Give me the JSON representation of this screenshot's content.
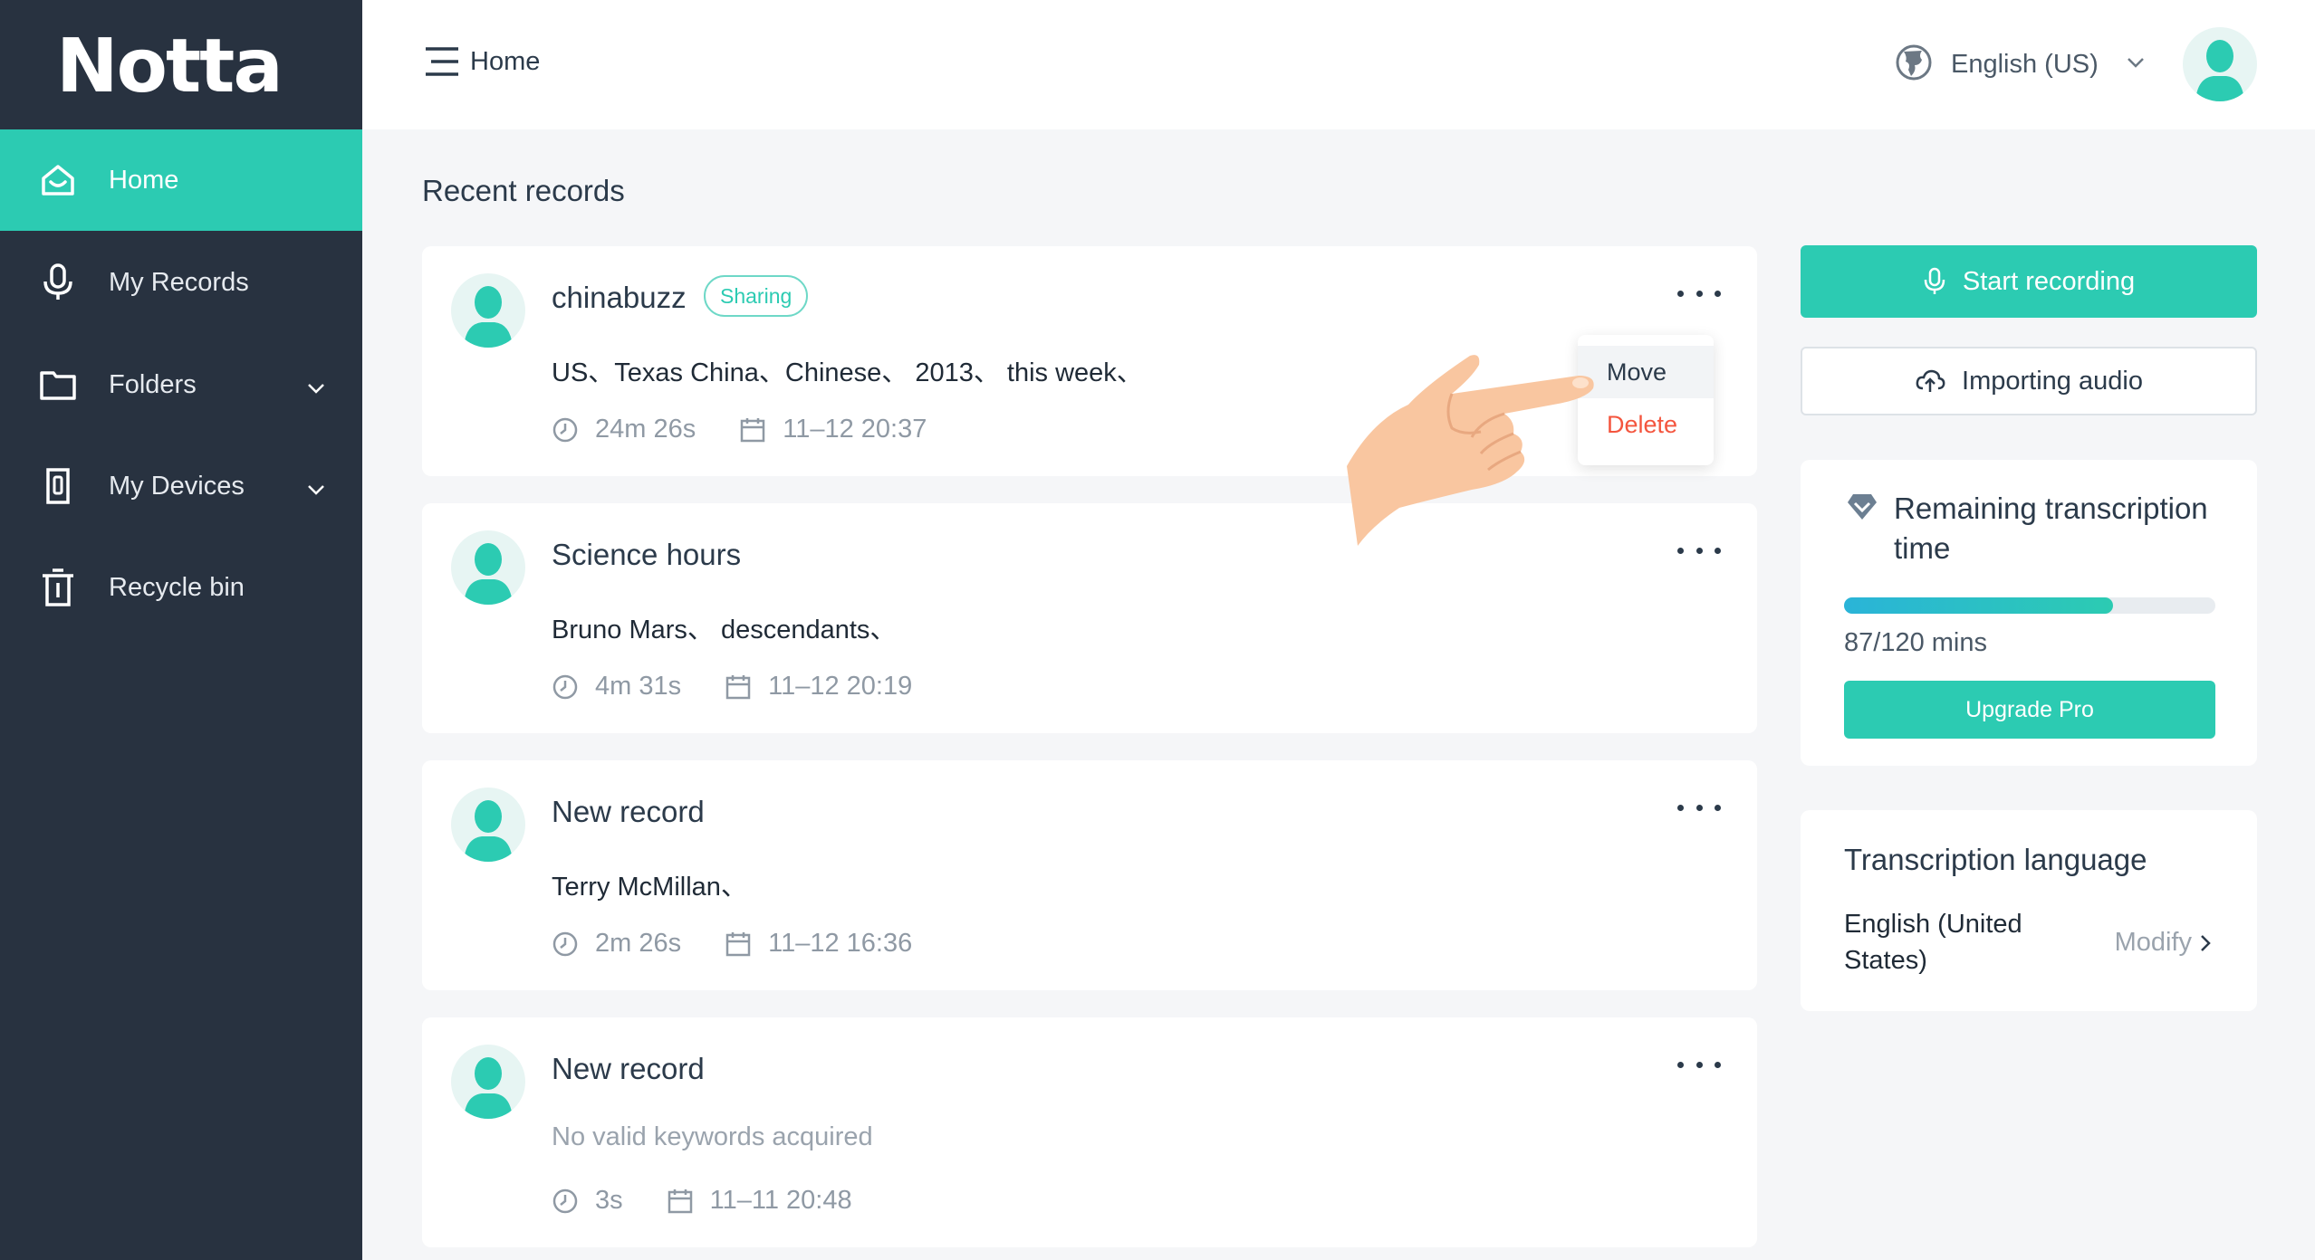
{
  "app": {
    "logo_text": "Notta",
    "accent_color": "#2ccbb2",
    "sidebar_color": "#283240"
  },
  "sidebar": {
    "items": [
      {
        "label": "Home",
        "icon": "home-icon",
        "active": true
      },
      {
        "label": "My Records",
        "icon": "microphone-icon"
      },
      {
        "label": "Folders",
        "icon": "folder-icon",
        "expandable": true
      },
      {
        "label": "My Devices",
        "icon": "device-icon",
        "expandable": true
      },
      {
        "label": "Recycle bin",
        "icon": "trash-icon"
      }
    ]
  },
  "header": {
    "breadcrumb": "Home",
    "language": "English (US)"
  },
  "main": {
    "section_title": "Recent records",
    "records": [
      {
        "title": "chinabuzz",
        "tag": "Sharing",
        "keywords": "US、Texas China、Chinese、 2013、 this week、",
        "duration": "24m 26s",
        "datetime": "11–12 20:37"
      },
      {
        "title": "Science hours",
        "keywords": "Bruno Mars、 descendants、",
        "duration": "4m 31s",
        "datetime": "11–12 20:19"
      },
      {
        "title": "New record",
        "keywords": "Terry McMillan、",
        "duration": "2m 26s",
        "datetime": "11–12 16:36"
      },
      {
        "title": "New record",
        "keywords": "No valid keywords acquired",
        "duration": "3s",
        "datetime": "11–11 20:48"
      }
    ],
    "dropdown": {
      "move": "Move",
      "delete": "Delete"
    }
  },
  "right": {
    "start_recording": "Start recording",
    "importing_audio": "Importing audio",
    "remaining": {
      "title": "Remaining transcription time",
      "usage": "87/120 mins",
      "used_fraction": 0.725,
      "upgrade": "Upgrade Pro"
    },
    "transcription_language": {
      "title": "Transcription language",
      "value": "English (United States)",
      "modify": "Modify"
    }
  }
}
